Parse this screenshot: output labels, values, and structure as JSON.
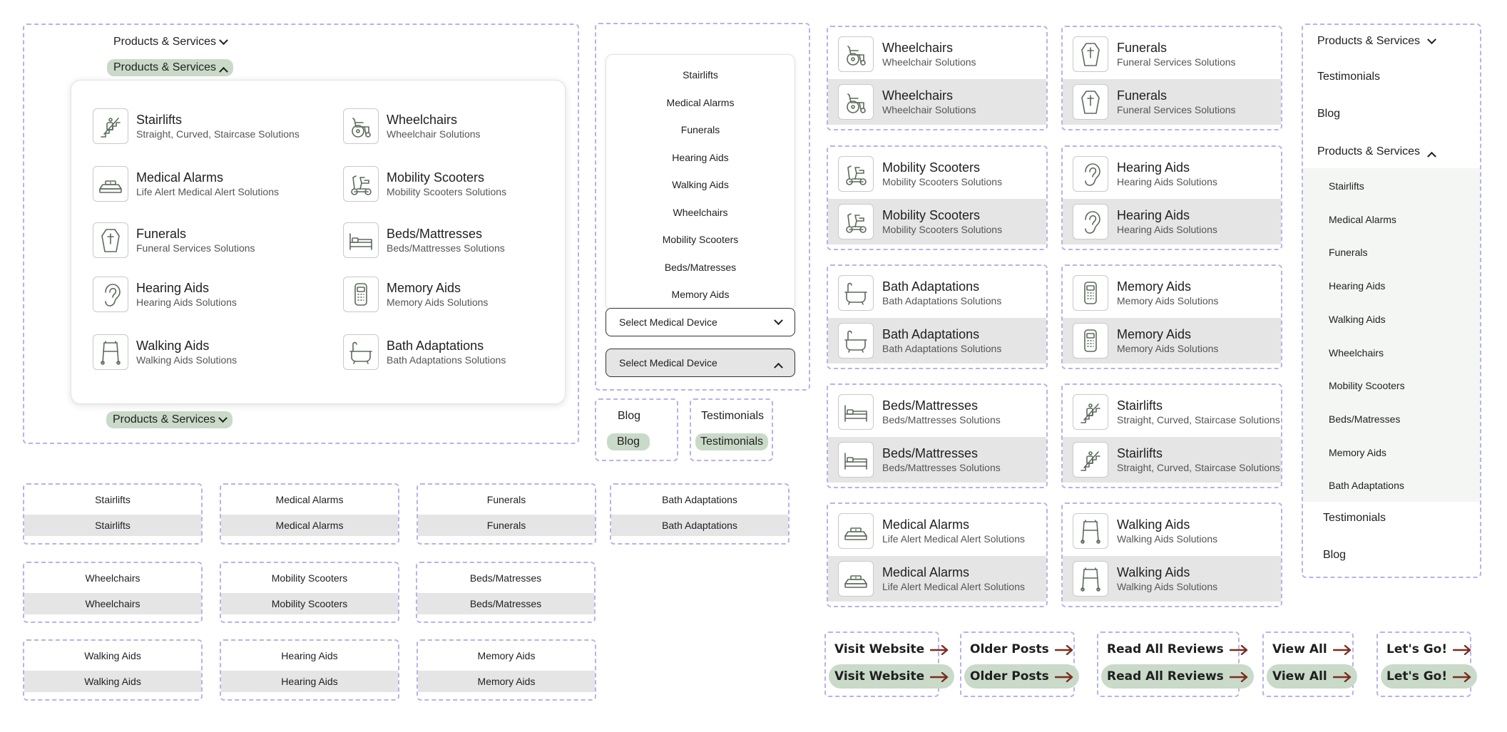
{
  "products_label": "Products & Services",
  "mega_menu": [
    {
      "icon": "stairlift-icon",
      "title": "Stairlifts",
      "sub": "Straight, Curved, Staircase Solutions"
    },
    {
      "icon": "wheelchair-icon",
      "title": "Wheelchairs",
      "sub": "Wheelchair Solutions"
    },
    {
      "icon": "medical-alarm-icon",
      "title": "Medical Alarms",
      "sub": "Life Alert Medical Alert Solutions"
    },
    {
      "icon": "mobility-scooter-icon",
      "title": "Mobility Scooters",
      "sub": "Mobility Scooters Solutions"
    },
    {
      "icon": "coffin-icon",
      "title": "Funerals",
      "sub": "Funeral Services Solutions"
    },
    {
      "icon": "bed-icon",
      "title": "Beds/Mattresses",
      "sub": "Beds/Mattresses Solutions"
    },
    {
      "icon": "ear-icon",
      "title": "Hearing Aids",
      "sub": "Hearing Aids Solutions"
    },
    {
      "icon": "memory-aid-icon",
      "title": "Memory Aids",
      "sub": "Memory Aids Solutions"
    },
    {
      "icon": "walker-icon",
      "title": "Walking Aids",
      "sub": "Walking Aids Solutions"
    },
    {
      "icon": "bathtub-icon",
      "title": "Bath Adaptations",
      "sub": "Bath Adaptations Solutions"
    }
  ],
  "dropdown_list": [
    "Stairlifts",
    "Medical Alarms",
    "Funerals",
    "Hearing Aids",
    "Walking Aids",
    "Wheelchairs",
    "Mobility Scooters",
    "Beds/Matresses",
    "Memory Aids"
  ],
  "select_label": "Select Medical Device",
  "blog_label": "Blog",
  "testimonials_label": "Testimonials",
  "simple_items": [
    [
      "Stairlifts",
      "Medical Alarms",
      "Funerals",
      "Bath Adaptations"
    ],
    [
      "Wheelchairs",
      "Mobility Scooters",
      "Beds/Matresses"
    ],
    [
      "Walking Aids",
      "Hearing Aids",
      "Memory Aids"
    ]
  ],
  "cards": [
    {
      "icon": "wheelchair-icon",
      "title": "Wheelchairs",
      "sub": "Wheelchair Solutions"
    },
    {
      "icon": "coffin-icon",
      "title": "Funerals",
      "sub": "Funeral Services Solutions"
    },
    {
      "icon": "mobility-scooter-icon",
      "title": "Mobility Scooters",
      "sub": "Mobility Scooters Solutions"
    },
    {
      "icon": "ear-icon",
      "title": "Hearing Aids",
      "sub": "Hearing Aids Solutions"
    },
    {
      "icon": "bathtub-icon",
      "title": "Bath Adaptations",
      "sub": "Bath Adaptations Solutions"
    },
    {
      "icon": "memory-aid-icon",
      "title": "Memory Aids",
      "sub": "Memory Aids Solutions"
    },
    {
      "icon": "bed-icon",
      "title": "Beds/Mattresses",
      "sub": "Beds/Mattresses Solutions"
    },
    {
      "icon": "stairlift-icon",
      "title": "Stairlifts",
      "sub": "Straight, Curved, Staircase Solutions"
    },
    {
      "icon": "medical-alarm-icon",
      "title": "Medical Alarms",
      "sub": "Life Alert Medical Alert Solutions"
    },
    {
      "icon": "walker-icon",
      "title": "Walking Aids",
      "sub": "Walking Aids Solutions"
    }
  ],
  "mobile_nav": {
    "submenu": [
      "Stairlifts",
      "Medical Alarms",
      "Funerals",
      "Hearing Aids",
      "Walking Aids",
      "Wheelchairs",
      "Mobility Scooters",
      "Beds/Matresses",
      "Memory Aids",
      "Bath Adaptations"
    ]
  },
  "ctas": [
    "Visit Website",
    "Older Posts",
    "Read All Reviews",
    "View All",
    "Let's Go!"
  ],
  "colors": {
    "accent_pill": "#c9dac8",
    "dashed_border": "#b9b2e8",
    "arrow": "#7a2d1f",
    "hover_grey": "#e5e5e5"
  }
}
